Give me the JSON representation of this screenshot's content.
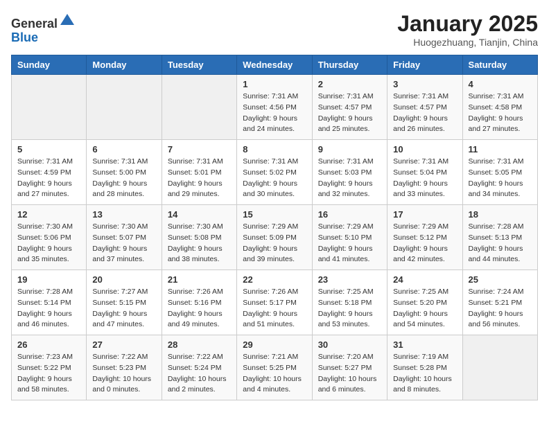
{
  "header": {
    "logo_line1": "General",
    "logo_line2": "Blue",
    "month": "January 2025",
    "location": "Huogezhuang, Tianjin, China"
  },
  "weekdays": [
    "Sunday",
    "Monday",
    "Tuesday",
    "Wednesday",
    "Thursday",
    "Friday",
    "Saturday"
  ],
  "weeks": [
    [
      {
        "day": "",
        "info": ""
      },
      {
        "day": "",
        "info": ""
      },
      {
        "day": "",
        "info": ""
      },
      {
        "day": "1",
        "info": "Sunrise: 7:31 AM\nSunset: 4:56 PM\nDaylight: 9 hours\nand 24 minutes."
      },
      {
        "day": "2",
        "info": "Sunrise: 7:31 AM\nSunset: 4:57 PM\nDaylight: 9 hours\nand 25 minutes."
      },
      {
        "day": "3",
        "info": "Sunrise: 7:31 AM\nSunset: 4:57 PM\nDaylight: 9 hours\nand 26 minutes."
      },
      {
        "day": "4",
        "info": "Sunrise: 7:31 AM\nSunset: 4:58 PM\nDaylight: 9 hours\nand 27 minutes."
      }
    ],
    [
      {
        "day": "5",
        "info": "Sunrise: 7:31 AM\nSunset: 4:59 PM\nDaylight: 9 hours\nand 27 minutes."
      },
      {
        "day": "6",
        "info": "Sunrise: 7:31 AM\nSunset: 5:00 PM\nDaylight: 9 hours\nand 28 minutes."
      },
      {
        "day": "7",
        "info": "Sunrise: 7:31 AM\nSunset: 5:01 PM\nDaylight: 9 hours\nand 29 minutes."
      },
      {
        "day": "8",
        "info": "Sunrise: 7:31 AM\nSunset: 5:02 PM\nDaylight: 9 hours\nand 30 minutes."
      },
      {
        "day": "9",
        "info": "Sunrise: 7:31 AM\nSunset: 5:03 PM\nDaylight: 9 hours\nand 32 minutes."
      },
      {
        "day": "10",
        "info": "Sunrise: 7:31 AM\nSunset: 5:04 PM\nDaylight: 9 hours\nand 33 minutes."
      },
      {
        "day": "11",
        "info": "Sunrise: 7:31 AM\nSunset: 5:05 PM\nDaylight: 9 hours\nand 34 minutes."
      }
    ],
    [
      {
        "day": "12",
        "info": "Sunrise: 7:30 AM\nSunset: 5:06 PM\nDaylight: 9 hours\nand 35 minutes."
      },
      {
        "day": "13",
        "info": "Sunrise: 7:30 AM\nSunset: 5:07 PM\nDaylight: 9 hours\nand 37 minutes."
      },
      {
        "day": "14",
        "info": "Sunrise: 7:30 AM\nSunset: 5:08 PM\nDaylight: 9 hours\nand 38 minutes."
      },
      {
        "day": "15",
        "info": "Sunrise: 7:29 AM\nSunset: 5:09 PM\nDaylight: 9 hours\nand 39 minutes."
      },
      {
        "day": "16",
        "info": "Sunrise: 7:29 AM\nSunset: 5:10 PM\nDaylight: 9 hours\nand 41 minutes."
      },
      {
        "day": "17",
        "info": "Sunrise: 7:29 AM\nSunset: 5:12 PM\nDaylight: 9 hours\nand 42 minutes."
      },
      {
        "day": "18",
        "info": "Sunrise: 7:28 AM\nSunset: 5:13 PM\nDaylight: 9 hours\nand 44 minutes."
      }
    ],
    [
      {
        "day": "19",
        "info": "Sunrise: 7:28 AM\nSunset: 5:14 PM\nDaylight: 9 hours\nand 46 minutes."
      },
      {
        "day": "20",
        "info": "Sunrise: 7:27 AM\nSunset: 5:15 PM\nDaylight: 9 hours\nand 47 minutes."
      },
      {
        "day": "21",
        "info": "Sunrise: 7:26 AM\nSunset: 5:16 PM\nDaylight: 9 hours\nand 49 minutes."
      },
      {
        "day": "22",
        "info": "Sunrise: 7:26 AM\nSunset: 5:17 PM\nDaylight: 9 hours\nand 51 minutes."
      },
      {
        "day": "23",
        "info": "Sunrise: 7:25 AM\nSunset: 5:18 PM\nDaylight: 9 hours\nand 53 minutes."
      },
      {
        "day": "24",
        "info": "Sunrise: 7:25 AM\nSunset: 5:20 PM\nDaylight: 9 hours\nand 54 minutes."
      },
      {
        "day": "25",
        "info": "Sunrise: 7:24 AM\nSunset: 5:21 PM\nDaylight: 9 hours\nand 56 minutes."
      }
    ],
    [
      {
        "day": "26",
        "info": "Sunrise: 7:23 AM\nSunset: 5:22 PM\nDaylight: 9 hours\nand 58 minutes."
      },
      {
        "day": "27",
        "info": "Sunrise: 7:22 AM\nSunset: 5:23 PM\nDaylight: 10 hours\nand 0 minutes."
      },
      {
        "day": "28",
        "info": "Sunrise: 7:22 AM\nSunset: 5:24 PM\nDaylight: 10 hours\nand 2 minutes."
      },
      {
        "day": "29",
        "info": "Sunrise: 7:21 AM\nSunset: 5:25 PM\nDaylight: 10 hours\nand 4 minutes."
      },
      {
        "day": "30",
        "info": "Sunrise: 7:20 AM\nSunset: 5:27 PM\nDaylight: 10 hours\nand 6 minutes."
      },
      {
        "day": "31",
        "info": "Sunrise: 7:19 AM\nSunset: 5:28 PM\nDaylight: 10 hours\nand 8 minutes."
      },
      {
        "day": "",
        "info": ""
      }
    ]
  ]
}
